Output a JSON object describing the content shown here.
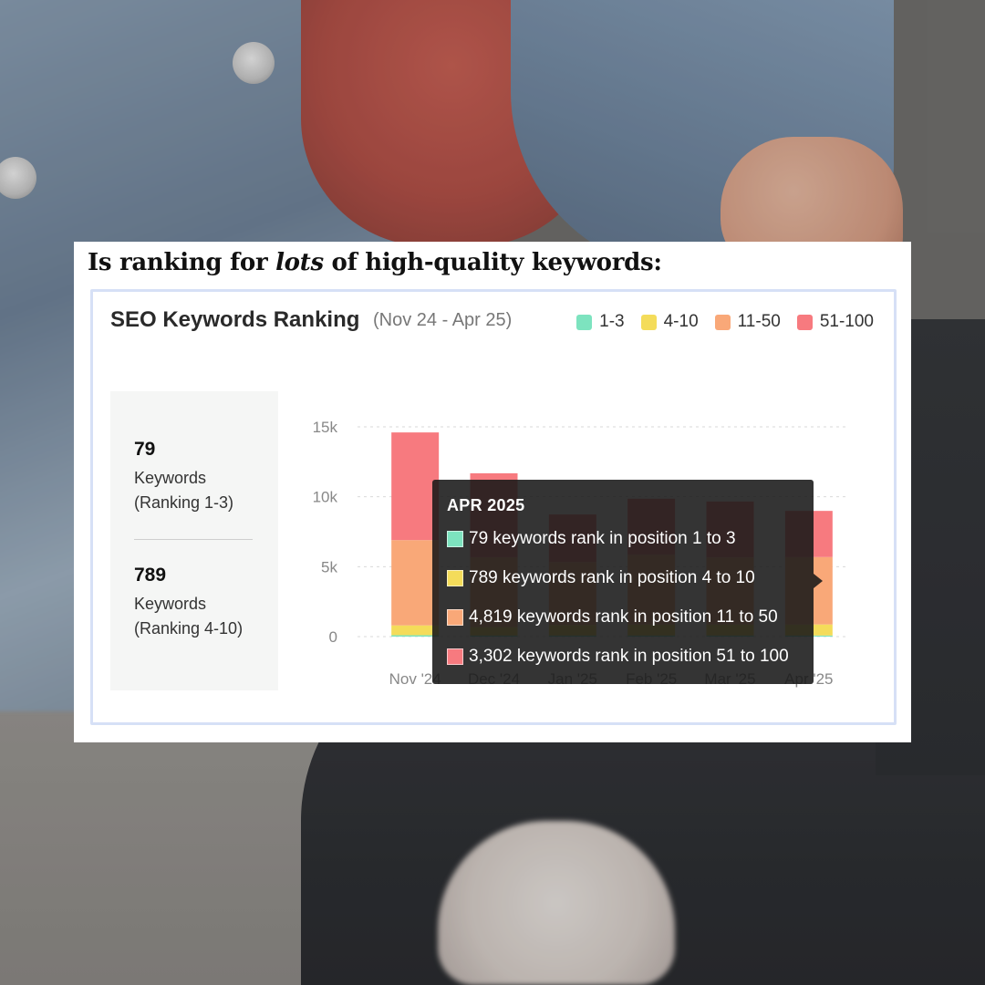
{
  "headline": {
    "prefix": "Is ranking for ",
    "emphasis": "lots",
    "suffix": " of high-quality keywords:"
  },
  "chart_header": {
    "title": "SEO Keywords Ranking",
    "subtitle": "(Nov 24 - Apr 25)"
  },
  "side_stats": [
    {
      "value": "79",
      "label_line1": "Keywords",
      "label_line2": "(Ranking 1-3)"
    },
    {
      "value": "789",
      "label_line1": "Keywords",
      "label_line2": "(Ranking 4-10)"
    }
  ],
  "tooltip": {
    "title": "APR 2025",
    "rows": [
      {
        "text": "79 keywords rank in position 1 to 3",
        "color": "#7de3bf"
      },
      {
        "text": "789 keywords rank in position 4 to 10",
        "color": "#f4dc5a"
      },
      {
        "text": "4,819 keywords rank in position 11 to 50",
        "color": "#f9a878"
      },
      {
        "text": "3,302 keywords rank in position 51 to 100",
        "color": "#f77a7f"
      }
    ]
  },
  "chart_data": {
    "type": "bar",
    "stacked": true,
    "title": "SEO Keywords Ranking",
    "subtitle": "(Nov 24 - Apr 25)",
    "categories": [
      "Nov '24",
      "Dec '24",
      "Jan '25",
      "Feb '25",
      "Mar '25",
      "Apr '25"
    ],
    "y_ticks": [
      "15k",
      "10k",
      "5k",
      "0"
    ],
    "ylim": [
      0,
      15000
    ],
    "grid": true,
    "legend_position": "top-right",
    "series": [
      {
        "name": "1-3",
        "color": "#7de3bf",
        "values": [
          100,
          80,
          80,
          80,
          80,
          79
        ]
      },
      {
        "name": "4-10",
        "color": "#f4dc5a",
        "values": [
          700,
          600,
          750,
          780,
          780,
          789
        ]
      },
      {
        "name": "11-50",
        "color": "#f9a878",
        "values": [
          6100,
          5000,
          4500,
          5000,
          4800,
          4819
        ]
      },
      {
        "name": "51-100",
        "color": "#f77a7f",
        "values": [
          7700,
          6000,
          3400,
          4000,
          4000,
          3302
        ]
      }
    ]
  }
}
